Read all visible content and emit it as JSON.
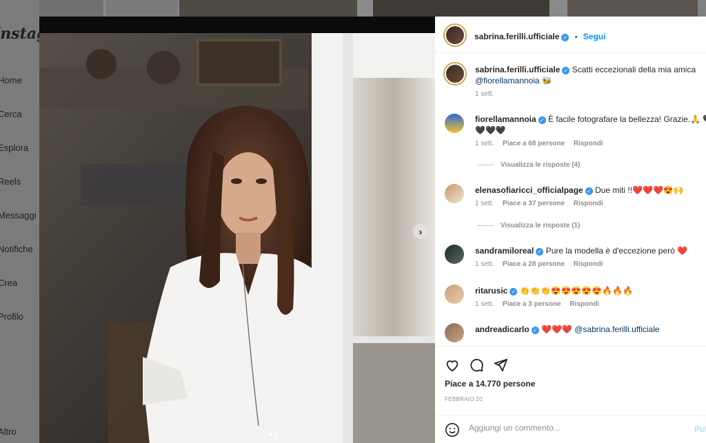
{
  "sidebar": {
    "logo": "Instagram",
    "items": [
      {
        "label": "Home"
      },
      {
        "label": "Cerca"
      },
      {
        "label": "Esplora"
      },
      {
        "label": "Reels"
      },
      {
        "label": "Messaggi"
      },
      {
        "label": "Notifiche"
      },
      {
        "label": "Crea"
      },
      {
        "label": "Profilo"
      },
      {
        "label": "Altro"
      }
    ]
  },
  "post": {
    "author": "sabrina.ferilli.ufficiale",
    "follow_label": "Segui",
    "separator": "•",
    "caption_text": "Scatti eccezionali della mia amica",
    "caption_mention": "@fiorellamannoia",
    "caption_emoji": "🐝",
    "caption_time": "1 sett.",
    "likes": "Piace a 14.770 persone",
    "date": "FEBBRAIO 20",
    "carousel_next": "›"
  },
  "comments": [
    {
      "user": "fiorellamannoia",
      "text_line1": "È facile fotografare la bellezza! Grazie.🙏 🖤",
      "text_line2": "🖤🖤🖤",
      "time": "1 sett.",
      "likes": "Piace a 68 persone",
      "reply": "Rispondi",
      "view_replies": "Visualizza le risposte (4)"
    },
    {
      "user": "elenasofiaricci_officialpage",
      "text": "Due miti !!❤️❤️❤️😍🙌",
      "time": "1 sett.",
      "likes": "Piace a 37 persone",
      "reply": "Rispondi",
      "view_replies": "Visualizza le risposte (1)"
    },
    {
      "user": "sandramiloreal",
      "text": "Pure la modella è d'eccezione però ❤️",
      "time": "1 sett.",
      "likes": "Piace a 28 persone",
      "reply": "Rispondi"
    },
    {
      "user": "ritarusic",
      "text": "👏👏👏😍😍😍😍😍🔥🔥🔥",
      "time": "1 sett.",
      "likes": "Piace a 3 persone",
      "reply": "Rispondi"
    },
    {
      "user": "andreadicarlo",
      "text": "❤️❤️❤️",
      "mention": "@sabrina.ferilli.ufficiale"
    }
  ],
  "comment_box": {
    "placeholder": "Aggiungi un commento...",
    "post_label": "Pubblica"
  },
  "colors": {
    "accent": "#0095f6",
    "verified": "#3897f0",
    "heart": "#ed4956"
  },
  "icons": [
    "heart-icon",
    "comment-icon",
    "share-icon",
    "emoji-icon",
    "verified-icon",
    "chevron-right-icon"
  ]
}
